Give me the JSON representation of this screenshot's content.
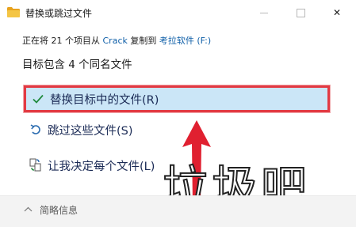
{
  "window": {
    "title": "替换或跳过文件",
    "minimize_icon": "minimize-icon",
    "maximize_icon": "maximize-icon",
    "close_icon": "close-icon",
    "close_glyph": "✕"
  },
  "progress": {
    "prefix": "正在将 21 个项目从",
    "source": "Crack",
    "middle": "复制到",
    "destination": "考拉软件 (F:)"
  },
  "heading": "目标包含 4 个同名文件",
  "options": [
    {
      "label": "替换目标中的文件(R)",
      "icon": "checkmark-icon",
      "selected": true
    },
    {
      "label": "跳过这些文件(S)",
      "icon": "skip-arrow-icon",
      "selected": false
    },
    {
      "label": "让我决定每个文件(L)",
      "icon": "decide-files-icon",
      "selected": false
    }
  ],
  "footer": {
    "details_label": "简略信息",
    "icon": "chevron-up-icon"
  },
  "overlay": {
    "watermark_text": "垃圾吧",
    "accent": "#e23a43"
  }
}
